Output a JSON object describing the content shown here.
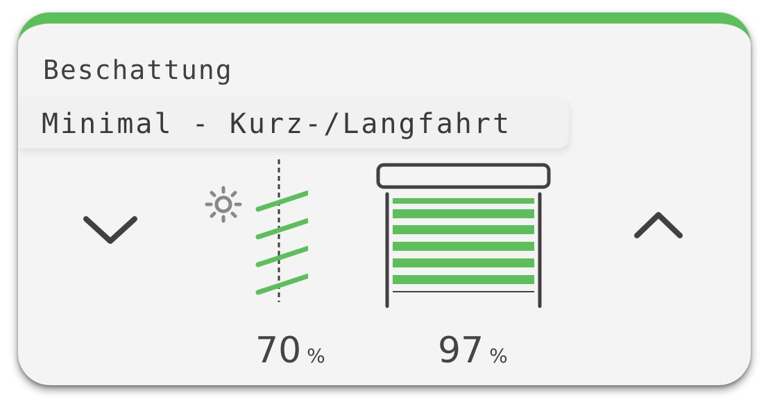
{
  "card": {
    "title": "Beschattung",
    "mode": "Minimal - Kurz-/Langfahrt",
    "accent_color": "#5cbf5c"
  },
  "controls": {
    "down_icon": "chevron-down-icon",
    "up_icon": "chevron-up-icon"
  },
  "status": {
    "tilt_icon": "sun-slat-angle-icon",
    "tilt_value": "70",
    "tilt_unit": "%",
    "position_icon": "blind-position-icon",
    "position_value": "97",
    "position_unit": "%"
  }
}
